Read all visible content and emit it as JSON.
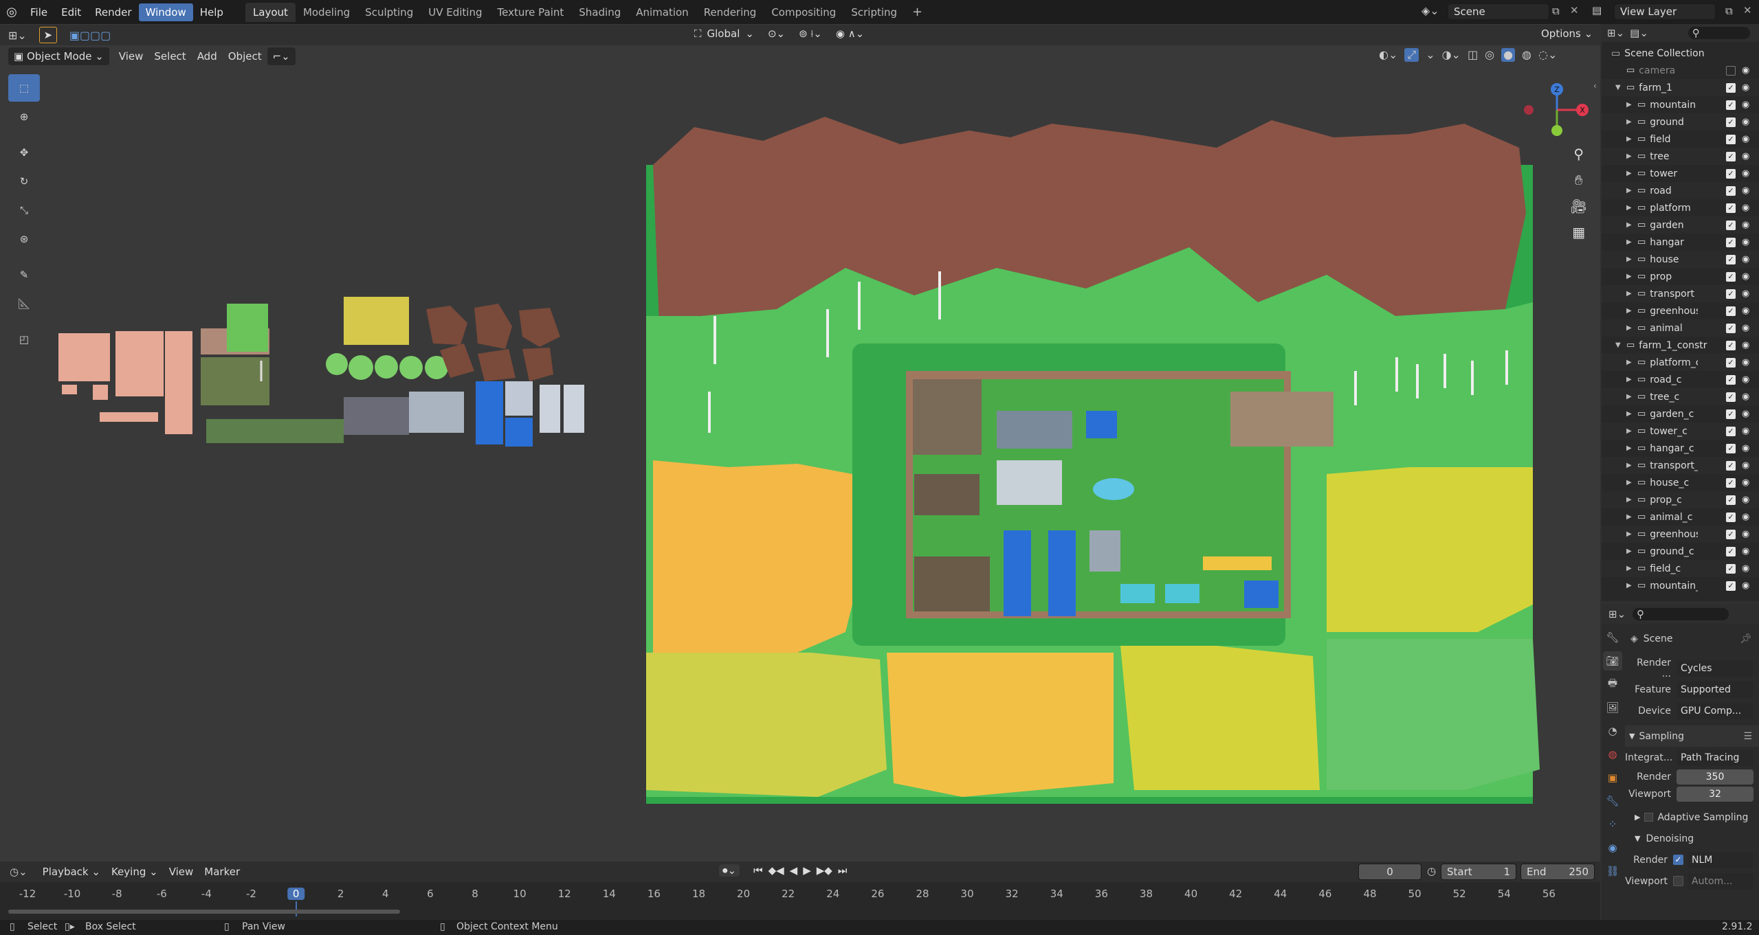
{
  "topbar": {
    "menus": [
      "File",
      "Edit",
      "Render",
      "Window",
      "Help"
    ],
    "workspaces": [
      "Layout",
      "Modeling",
      "Sculpting",
      "UV Editing",
      "Texture Paint",
      "Shading",
      "Animation",
      "Rendering",
      "Compositing",
      "Scripting"
    ],
    "add_workspace": "+",
    "scene_name": "Scene",
    "view_layer": "View Layer"
  },
  "viewport_header": {
    "mode": "Object Mode",
    "menus": [
      "View",
      "Select",
      "Add",
      "Object"
    ],
    "orientation": "Global",
    "options": "Options"
  },
  "gizmo": {
    "x": "X",
    "y": "Y",
    "z": "Z"
  },
  "outliner": {
    "root": "Scene Collection",
    "rows": [
      {
        "name": "camera",
        "level": 1
      },
      {
        "name": "farm_1",
        "level": 1
      },
      {
        "name": "mountain",
        "level": 2
      },
      {
        "name": "ground",
        "level": 2
      },
      {
        "name": "field",
        "level": 2
      },
      {
        "name": "tree",
        "level": 2
      },
      {
        "name": "tower",
        "level": 2
      },
      {
        "name": "road",
        "level": 2
      },
      {
        "name": "platform",
        "level": 2
      },
      {
        "name": "garden",
        "level": 2
      },
      {
        "name": "hangar",
        "level": 2
      },
      {
        "name": "house",
        "level": 2
      },
      {
        "name": "prop",
        "level": 2
      },
      {
        "name": "transport",
        "level": 2
      },
      {
        "name": "greenhous",
        "level": 2
      },
      {
        "name": "animal",
        "level": 2
      },
      {
        "name": "farm_1_constr",
        "level": 1
      },
      {
        "name": "platform_c",
        "level": 2
      },
      {
        "name": "road_c",
        "level": 2
      },
      {
        "name": "tree_c",
        "level": 2
      },
      {
        "name": "garden_c",
        "level": 2
      },
      {
        "name": "tower_c",
        "level": 2
      },
      {
        "name": "hangar_c",
        "level": 2
      },
      {
        "name": "transport_",
        "level": 2
      },
      {
        "name": "house_c",
        "level": 2
      },
      {
        "name": "prop_c",
        "level": 2
      },
      {
        "name": "animal_c",
        "level": 2
      },
      {
        "name": "greenhous",
        "level": 2
      },
      {
        "name": "ground_c",
        "level": 2
      },
      {
        "name": "field_c",
        "level": 2
      },
      {
        "name": "mountain_",
        "level": 2
      }
    ]
  },
  "properties": {
    "scene": "Scene",
    "render_engine_label": "Render ...",
    "render_engine": "Cycles",
    "feature_label": "Feature",
    "feature": "Supported",
    "device_label": "Device",
    "device": "GPU Comp...",
    "sampling": "Sampling",
    "integrator_label": "Integrat...",
    "integrator": "Path Tracing",
    "render_label": "Render",
    "render_samples": "350",
    "viewport_label": "Viewport",
    "viewport_samples": "32",
    "adaptive": "Adaptive Sampling",
    "denoising": "Denoising",
    "denoise_render_label": "Render",
    "denoise_render": "NLM",
    "denoise_viewport_label": "Viewport",
    "denoise_viewport": "Autom..."
  },
  "timeline": {
    "menus": [
      "Playback",
      "Keying",
      "View",
      "Marker"
    ],
    "current_frame": "0",
    "start_label": "Start",
    "start": "1",
    "end_label": "End",
    "end": "250",
    "ticks": [
      "-12",
      "-10",
      "-8",
      "-6",
      "-4",
      "-2",
      "0",
      "2",
      "4",
      "6",
      "8",
      "10",
      "12",
      "14",
      "16",
      "18",
      "20",
      "22",
      "24",
      "26",
      "28",
      "30",
      "32",
      "34",
      "36",
      "38",
      "40",
      "42",
      "44",
      "46",
      "48",
      "50",
      "52",
      "54",
      "56"
    ]
  },
  "statusbar": {
    "select": "Select",
    "box_select": "Box Select",
    "pan_view": "Pan View",
    "context_menu": "Object Context Menu",
    "version": "2.91.2"
  }
}
